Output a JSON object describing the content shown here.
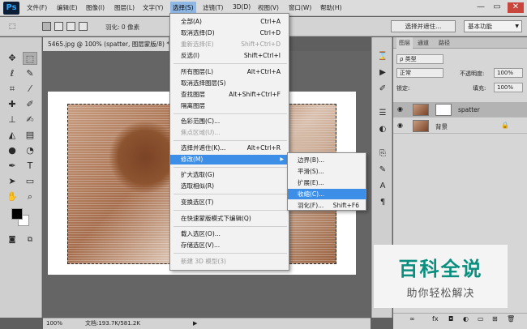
{
  "app": {
    "logo": "Ps"
  },
  "menubar": {
    "items": [
      "文件(F)",
      "编辑(E)",
      "图像(I)",
      "图层(L)",
      "文字(Y)",
      "选择(S)",
      "滤镜(T)",
      "3D(D)",
      "视图(V)",
      "窗口(W)",
      "帮助(H)"
    ],
    "active_index": 5
  },
  "window_controls": {
    "minimize": "—",
    "restore": "▭",
    "close": "✕"
  },
  "options_bar": {
    "feather_label": "羽化: 0 像素",
    "select_and_mask": "选择并遮住...",
    "workspace": "基本功能"
  },
  "document": {
    "tab_title": "5465.jpg @ 100% (spatter, 图层蒙版/8) *",
    "zoom": "100%",
    "doc_info": "文档:193.7K/581.2K"
  },
  "select_menu": {
    "items": [
      {
        "label": "全部(A)",
        "shortcut": "Ctrl+A",
        "disabled": false
      },
      {
        "label": "取消选择(D)",
        "shortcut": "Ctrl+D",
        "disabled": false
      },
      {
        "label": "重新选择(E)",
        "shortcut": "Shift+Ctrl+D",
        "disabled": true
      },
      {
        "label": "反选(I)",
        "shortcut": "Shift+Ctrl+I",
        "disabled": false
      },
      {
        "label": "所有图层(L)",
        "shortcut": "Alt+Ctrl+A",
        "disabled": false
      },
      {
        "label": "取消选择图层(S)",
        "shortcut": "",
        "disabled": false
      },
      {
        "label": "查找图层",
        "shortcut": "Alt+Shift+Ctrl+F",
        "disabled": false
      },
      {
        "label": "隔离图层",
        "shortcut": "",
        "disabled": false
      },
      {
        "label": "色彩范围(C)...",
        "shortcut": "",
        "disabled": false
      },
      {
        "label": "焦点区域(U)...",
        "shortcut": "",
        "disabled": true
      },
      {
        "label": "选择并遮住(K)...",
        "shortcut": "Alt+Ctrl+R",
        "disabled": false
      },
      {
        "label": "修改(M)",
        "shortcut": "",
        "disabled": false
      },
      {
        "label": "扩大选取(G)",
        "shortcut": "",
        "disabled": false
      },
      {
        "label": "选取相似(R)",
        "shortcut": "",
        "disabled": false
      },
      {
        "label": "变换选区(T)",
        "shortcut": "",
        "disabled": false
      },
      {
        "label": "在快速蒙版模式下编辑(Q)",
        "shortcut": "",
        "disabled": false
      },
      {
        "label": "载入选区(O)...",
        "shortcut": "",
        "disabled": false
      },
      {
        "label": "存储选区(V)...",
        "shortcut": "",
        "disabled": false
      },
      {
        "label": "新建 3D 模型(3)",
        "shortcut": "",
        "disabled": true
      }
    ],
    "highlighted_index": 11
  },
  "modify_submenu": {
    "items": [
      {
        "label": "边界(B)...",
        "shortcut": ""
      },
      {
        "label": "平滑(S)...",
        "shortcut": ""
      },
      {
        "label": "扩展(E)...",
        "shortcut": ""
      },
      {
        "label": "收缩(C)...",
        "shortcut": ""
      },
      {
        "label": "羽化(F)...",
        "shortcut": "Shift+F6"
      }
    ],
    "highlighted_index": 3
  },
  "layers_panel": {
    "tabs": [
      "图层",
      "通道",
      "路径"
    ],
    "filter_label": "ρ 类型",
    "blend_mode": "正常",
    "opacity_label": "不透明度:",
    "opacity_value": "100%",
    "lock_label": "锁定:",
    "fill_label": "填充:",
    "fill_value": "100%",
    "layers": [
      {
        "name": "spatter",
        "selected": true
      },
      {
        "name": "背景",
        "selected": false
      }
    ]
  },
  "watermark": {
    "title": "百科全说",
    "subtitle": "助你轻松解决"
  },
  "colors": {
    "accent": "#3d8ee6",
    "watermark": "#0a8f7e"
  }
}
